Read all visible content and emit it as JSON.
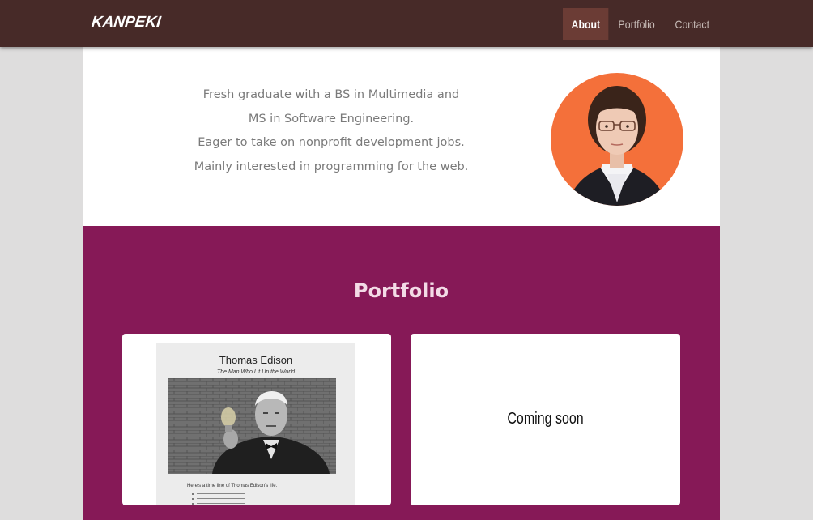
{
  "brand": "KANPEKI",
  "nav": {
    "about": "About",
    "portfolio": "Portfolio",
    "contact": "Contact"
  },
  "about": {
    "bio_lines": [
      "Fresh graduate with a BS in Multimedia and",
      "MS in Software Engineering.",
      "Eager to take on nonprofit development jobs.",
      "Mainly interested in programming for the web."
    ]
  },
  "portfolio": {
    "title": "Portfolio",
    "card1": {
      "thumb_title": "Thomas Edison",
      "thumb_subtitle": "The Man Who Lit Up the World",
      "thumb_body": "Here's a time line of Thomas Edison's life."
    },
    "card2": {
      "text": "Coming soon"
    }
  },
  "colors": {
    "navbar": "#472a28",
    "nav_active": "#6b3c35",
    "portfolio_bg": "#861957",
    "avatar_bg": "#f4703a",
    "page_bg": "#dedddd"
  }
}
